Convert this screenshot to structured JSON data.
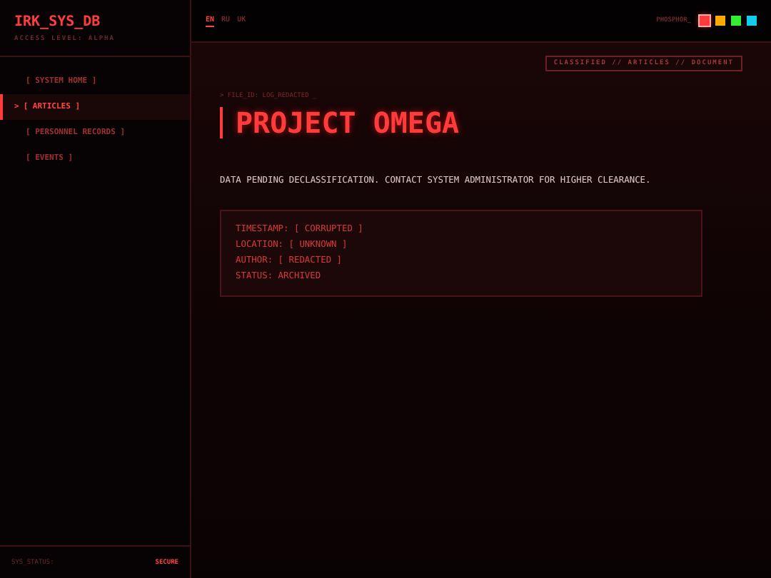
{
  "sidebar": {
    "title": "IRK_SYS_DB",
    "subtitle": "ACCESS LEVEL: ALPHA",
    "active_marker": ">",
    "items": [
      {
        "label": "[ SYSTEM HOME ]",
        "selected": false
      },
      {
        "label": "[ ARTICLES ]",
        "selected": true
      },
      {
        "label": "[ PERSONNEL RECORDS ]",
        "selected": false
      },
      {
        "label": "[ EVENTS ]",
        "selected": false
      }
    ],
    "status_label": "SYS_STATUS:",
    "status_value": "SECURE"
  },
  "topbar": {
    "languages": [
      {
        "label": "EN",
        "selected": true
      },
      {
        "label": "RU",
        "selected": false
      },
      {
        "label": "UK",
        "selected": false
      }
    ],
    "theme_label": "PHOSPHOR_",
    "themes": [
      {
        "color": "#ff3b3b",
        "selected": true
      },
      {
        "color": "#ffaa00",
        "selected": false
      },
      {
        "color": "#33ee33",
        "selected": false
      },
      {
        "color": "#11ccee",
        "selected": false
      }
    ]
  },
  "main": {
    "breadcrumb": "CLASSIFIED // ARTICLES // DOCUMENT",
    "file_id": "> FILE_ID: LOG_REDACTED _",
    "heading": "PROJECT OMEGA",
    "notice": "DATA PENDING DECLASSIFICATION. CONTACT SYSTEM ADMINISTRATOR FOR HIGHER CLEARANCE.",
    "meta": [
      "TIMESTAMP: [ CORRUPTED ]",
      "LOCATION: [ UNKNOWN ]",
      "AUTHOR: [ REDACTED ]",
      "STATUS: ARCHIVED"
    ]
  }
}
